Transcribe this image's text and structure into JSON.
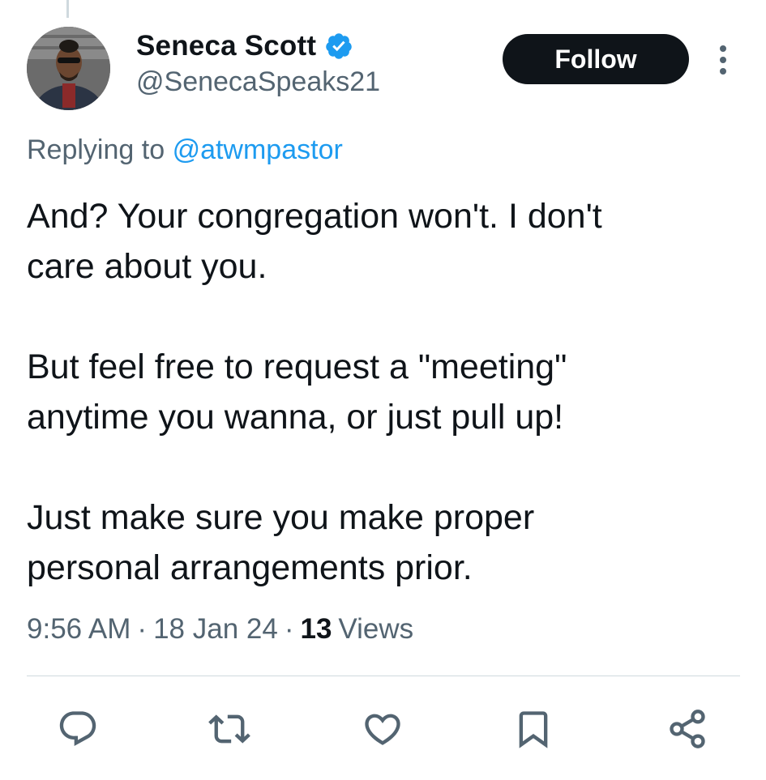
{
  "author": {
    "display_name": "Seneca Scott",
    "handle": "@SenecaSpeaks21",
    "verified": true,
    "verified_color": "#1d9bf0"
  },
  "follow_label": "Follow",
  "reply_context": {
    "prefix": "Replying to",
    "mention": "@atwmpastor"
  },
  "tweet": {
    "paragraphs": [
      "And?  Your congregation won't.  I don't\ncare about you.",
      "But feel free to request a \"meeting\"\nanytime you wanna, or just pull up!",
      "Just make sure you make proper\npersonal arrangements prior."
    ]
  },
  "meta": {
    "time": "9:56 AM",
    "separator": "·",
    "date": "18 Jan 24",
    "views_count": "13",
    "views_label": "Views"
  },
  "actions": [
    {
      "name": "reply",
      "icon": "reply-icon"
    },
    {
      "name": "retweet",
      "icon": "retweet-icon"
    },
    {
      "name": "like",
      "icon": "heart-icon"
    },
    {
      "name": "bookmark",
      "icon": "bookmark-icon"
    },
    {
      "name": "share",
      "icon": "share-icon"
    }
  ],
  "colors": {
    "text": "#0f1419",
    "secondary": "#536471",
    "accent": "#1d9bf0",
    "button": "#0f1419"
  }
}
